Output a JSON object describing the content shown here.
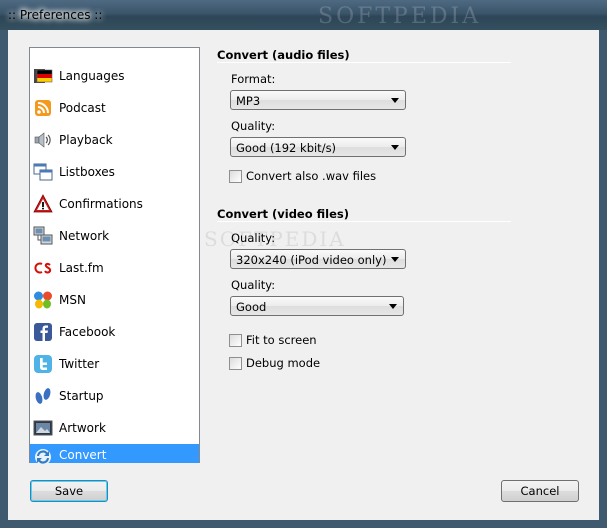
{
  "window": {
    "title": ":: Preferences ::",
    "watermark": "SOFTPEDIA"
  },
  "sidebar": {
    "items": [
      {
        "label": "Languages",
        "icon": "flag-icon"
      },
      {
        "label": "Podcast",
        "icon": "rss-icon"
      },
      {
        "label": "Playback",
        "icon": "speaker-icon"
      },
      {
        "label": "Listboxes",
        "icon": "windows-icon"
      },
      {
        "label": "Confirmations",
        "icon": "warning-icon"
      },
      {
        "label": "Network",
        "icon": "network-icon"
      },
      {
        "label": "Last.fm",
        "icon": "lastfm-icon"
      },
      {
        "label": "MSN",
        "icon": "msn-butterfly-icon"
      },
      {
        "label": "Facebook",
        "icon": "facebook-icon"
      },
      {
        "label": "Twitter",
        "icon": "twitter-icon"
      },
      {
        "label": "Startup",
        "icon": "footprints-icon"
      },
      {
        "label": "Artwork",
        "icon": "picture-icon"
      },
      {
        "label": "Convert",
        "icon": "convert-icon",
        "selected": true
      }
    ]
  },
  "audio": {
    "section_title": "Convert (audio files)",
    "format_label": "Format:",
    "format_value": "MP3",
    "quality_label": "Quality:",
    "quality_value": "Good (192 kbit/s)",
    "wav_label": "Convert also .wav files",
    "wav_checked": false
  },
  "video": {
    "section_title": "Convert (video files)",
    "resolution_label": "Quality:",
    "resolution_value": "320x240 (iPod video only)",
    "quality_label": "Quality:",
    "quality_value": "Good",
    "fit_label": "Fit to screen",
    "fit_checked": false,
    "debug_label": "Debug mode",
    "debug_checked": false
  },
  "buttons": {
    "save": "Save",
    "cancel": "Cancel"
  },
  "colors": {
    "selection": "#3399ff",
    "frame": "#3f5a6e"
  }
}
